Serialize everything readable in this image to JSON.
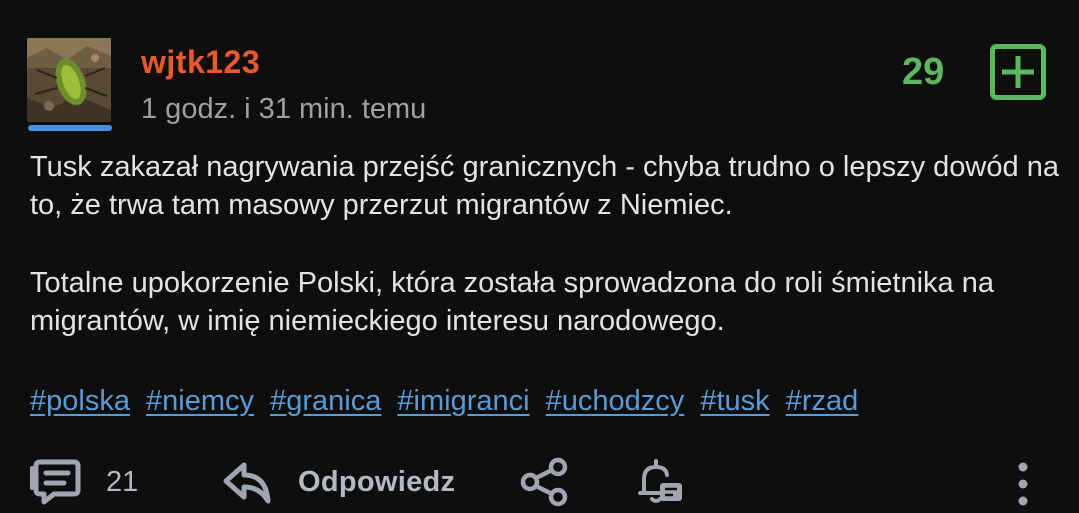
{
  "colors": {
    "background": "#0e0e0e",
    "username": "#e85a2d",
    "timestamp": "#a0a0a0",
    "body_text": "#e3e3e3",
    "vote": "#5cb85c",
    "tag_link": "#5b9bd5",
    "avatar_bar": "#4a90e2",
    "action_icon": "#9fa6b2",
    "action_label": "#b4bac4"
  },
  "post": {
    "author": "wjtk123",
    "time": "1 godz. i 31 min. temu",
    "vote_count": "29",
    "paragraphs": [
      "Tusk zakazał nagrywania przejść granicznych - chyba trudno o lepszy dowód na to, że trwa tam masowy przerzut migrantów z Niemiec.",
      "Totalne upokorzenie Polski, która została sprowadzona do roli śmietnika na migrantów, w imię niemieckiego interesu narodowego."
    ],
    "tags": [
      "#polska",
      "#niemcy",
      "#granica",
      "#imigranci",
      "#uchodzcy",
      "#tusk",
      "#rzad"
    ]
  },
  "actions": {
    "comments_icon": "comment-icon",
    "comments_count": "21",
    "reply_icon": "reply-icon",
    "reply_label": "Odpowiedz",
    "share_icon": "share-icon",
    "notify_icon": "bell-icon",
    "more_icon": "more-vertical-icon"
  }
}
